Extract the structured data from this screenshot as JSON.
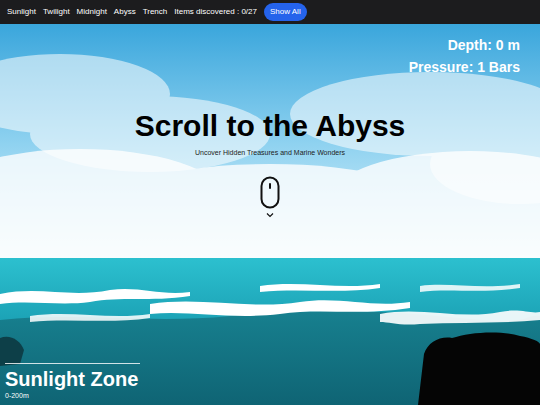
{
  "nav": {
    "items": [
      {
        "label": "Sunlight"
      },
      {
        "label": "Twilight"
      },
      {
        "label": "Midnight"
      },
      {
        "label": "Abyss"
      },
      {
        "label": "Trench"
      }
    ],
    "discovered": "Items discovered : 0/27",
    "button": "Show All"
  },
  "gauges": {
    "depth": "Depth: 0 m",
    "pressure": "Pressure: 1 Bars"
  },
  "hero": {
    "title": "Scroll to the Abyss",
    "subtitle": "Uncover Hidden Treasures and Marine Wonders"
  },
  "zone": {
    "name": "Sunlight Zone",
    "range": "0-200m"
  }
}
